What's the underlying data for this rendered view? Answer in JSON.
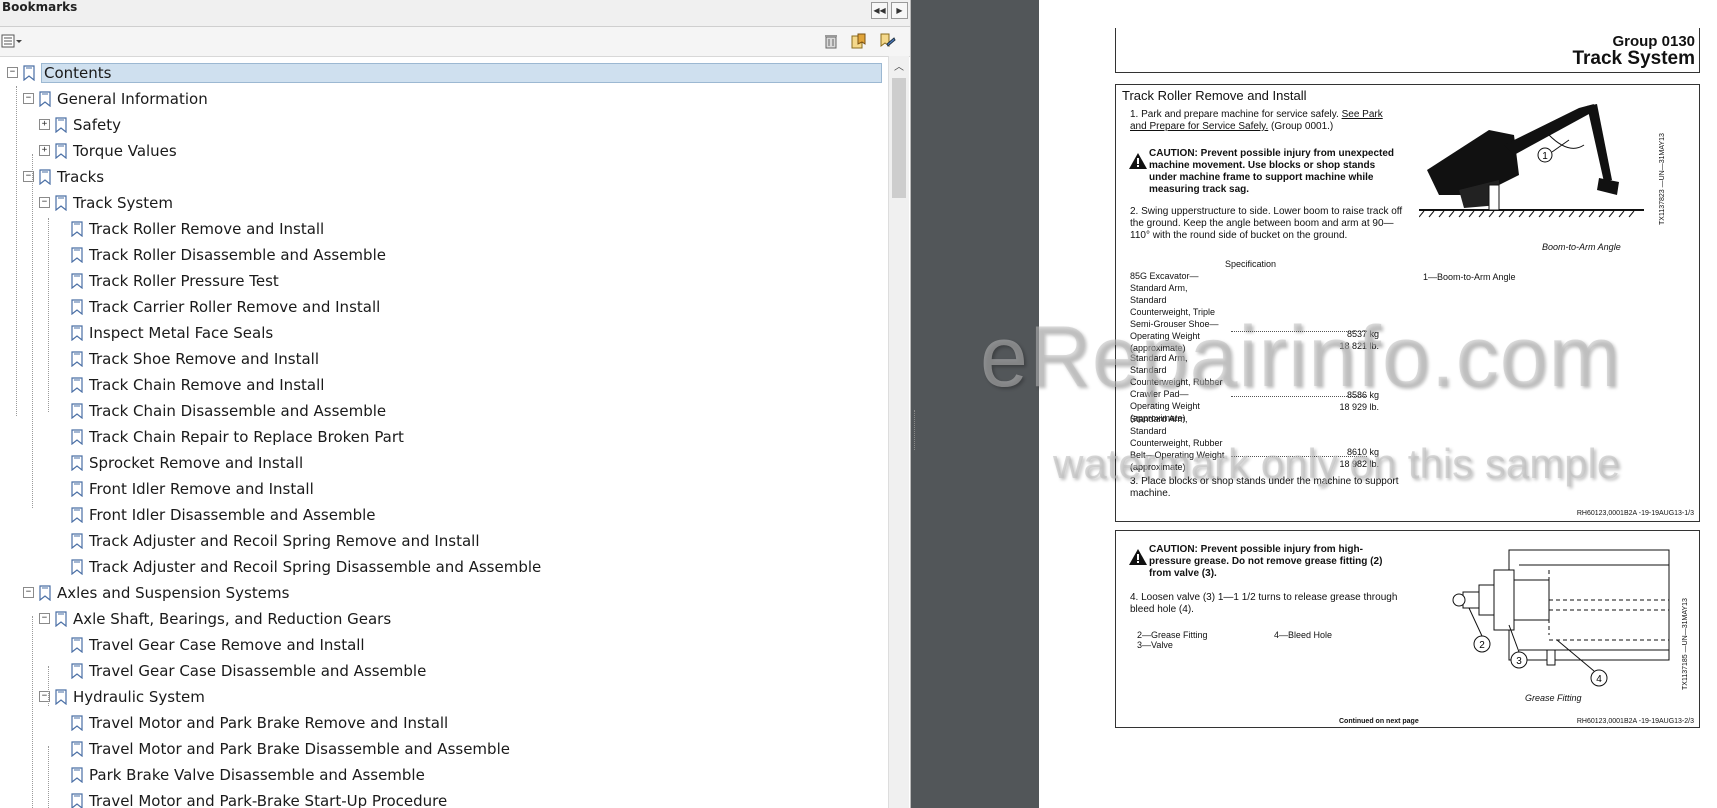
{
  "bookmarks_panel": {
    "title": "Bookmarks",
    "nav_prev": "◀◀",
    "nav_next": "▶",
    "options_icon": "options-menu-icon",
    "toolbar_icons": [
      "delete-bookmark-icon",
      "new-bookmark-icon",
      "bookmark-properties-icon"
    ],
    "items": [
      {
        "label": "Contents",
        "selected": true
      },
      {
        "label": "General Information"
      },
      {
        "label": "Safety"
      },
      {
        "label": "Torque Values"
      },
      {
        "label": "Tracks"
      },
      {
        "label": "Track System"
      },
      {
        "label": "Track Roller Remove and Install"
      },
      {
        "label": "Track Roller Disassemble and Assemble"
      },
      {
        "label": "Track Roller Pressure Test"
      },
      {
        "label": "Track Carrier Roller Remove and Install"
      },
      {
        "label": "Inspect Metal Face Seals"
      },
      {
        "label": "Track Shoe Remove and Install"
      },
      {
        "label": "Track Chain Remove and Install"
      },
      {
        "label": "Track Chain Disassemble and Assemble"
      },
      {
        "label": "Track Chain Repair to Replace Broken Part"
      },
      {
        "label": "Sprocket Remove and Install"
      },
      {
        "label": "Front Idler Remove and Install"
      },
      {
        "label": "Front Idler Disassemble and Assemble"
      },
      {
        "label": "Track Adjuster and Recoil Spring Remove and Install"
      },
      {
        "label": "Track Adjuster and Recoil Spring Disassemble and Assemble"
      },
      {
        "label": "Axles and Suspension Systems"
      },
      {
        "label": "Axle Shaft, Bearings, and Reduction Gears"
      },
      {
        "label": "Travel Gear Case Remove and Install"
      },
      {
        "label": "Travel Gear Case Disassemble and Assemble"
      },
      {
        "label": "Hydraulic System"
      },
      {
        "label": "Travel Motor and Park Brake Remove and Install"
      },
      {
        "label": "Travel Motor and Park Brake Disassemble and Assemble"
      },
      {
        "label": "Park Brake Valve Disassemble and Assemble"
      },
      {
        "label": "Travel Motor and Park-Brake Start-Up Procedure"
      }
    ]
  },
  "document": {
    "group": "Group  0130",
    "section": "Track System",
    "section1": {
      "heading": "Track Roller Remove and Install",
      "step1": "1.  Park and prepare machine for service safely.",
      "step1_link": "See Park and Prepare for Service Safely.",
      "step1_tail": "(Group 0001.)",
      "caution1": "CAUTION: Prevent possible injury from unexpected machine movement. Use blocks or shop stands under machine frame to support machine while measuring track sag.",
      "step2": "2.  Swing upperstructure to side.  Lower boom to raise track off the ground.  Keep the angle between boom and arm at 90—110° with the round side of bucket on the ground.",
      "spec_heading": "Specification",
      "spec1_label": "85G Excavator—Standard Arm, Standard Counterweight, Triple Semi-Grouser Shoe—Operating Weight (approximate)",
      "spec1_value": "8537 kg",
      "spec1_value2": "18 821 lb.",
      "spec2_label": "Standard Arm, Standard Counterweight, Rubber Crawler Pad—Operating Weight (approximate)",
      "spec2_value": "8586 kg",
      "spec2_value2": "18 929 lb.",
      "spec3_label": "Standard Arm, Standard Counterweight, Rubber Belt—Operating Weight (approximate)",
      "spec3_value": "8610 kg",
      "spec3_value2": "18 982 lb.",
      "step3": "3.  Place blocks or shop stands under the machine to support machine.",
      "figure_caption": "Boom-to-Arm Angle",
      "figure_id": "TX1137823 —UN—31MAY13",
      "callout_1": "1",
      "legend": "1—Boom-to-Arm Angle",
      "ref": "RH60123,0001B2A -19-19AUG13-1/3"
    },
    "section2": {
      "caution2": "CAUTION: Prevent possible injury from high-pressure grease.  Do not remove grease fitting (2) from valve (3).",
      "step4": "4.  Loosen valve (3) 1—1 1/2 turns to release grease through bleed hole (4).",
      "legend_a": "2—Grease Fitting",
      "legend_b": "3—Valve",
      "legend_c": "4—Bleed Hole",
      "figure_caption": "Grease Fitting",
      "figure_id": "TX1137185 —UN—31MAY13",
      "callout_2": "2",
      "callout_3": "3",
      "callout_4": "4",
      "continued": "Continued on next page",
      "ref": "RH60123,0001B2A -19-19AUG13-2/3"
    }
  },
  "watermark": {
    "line1": "eRepairinfo.com",
    "line2": "watermark only on this sample"
  }
}
